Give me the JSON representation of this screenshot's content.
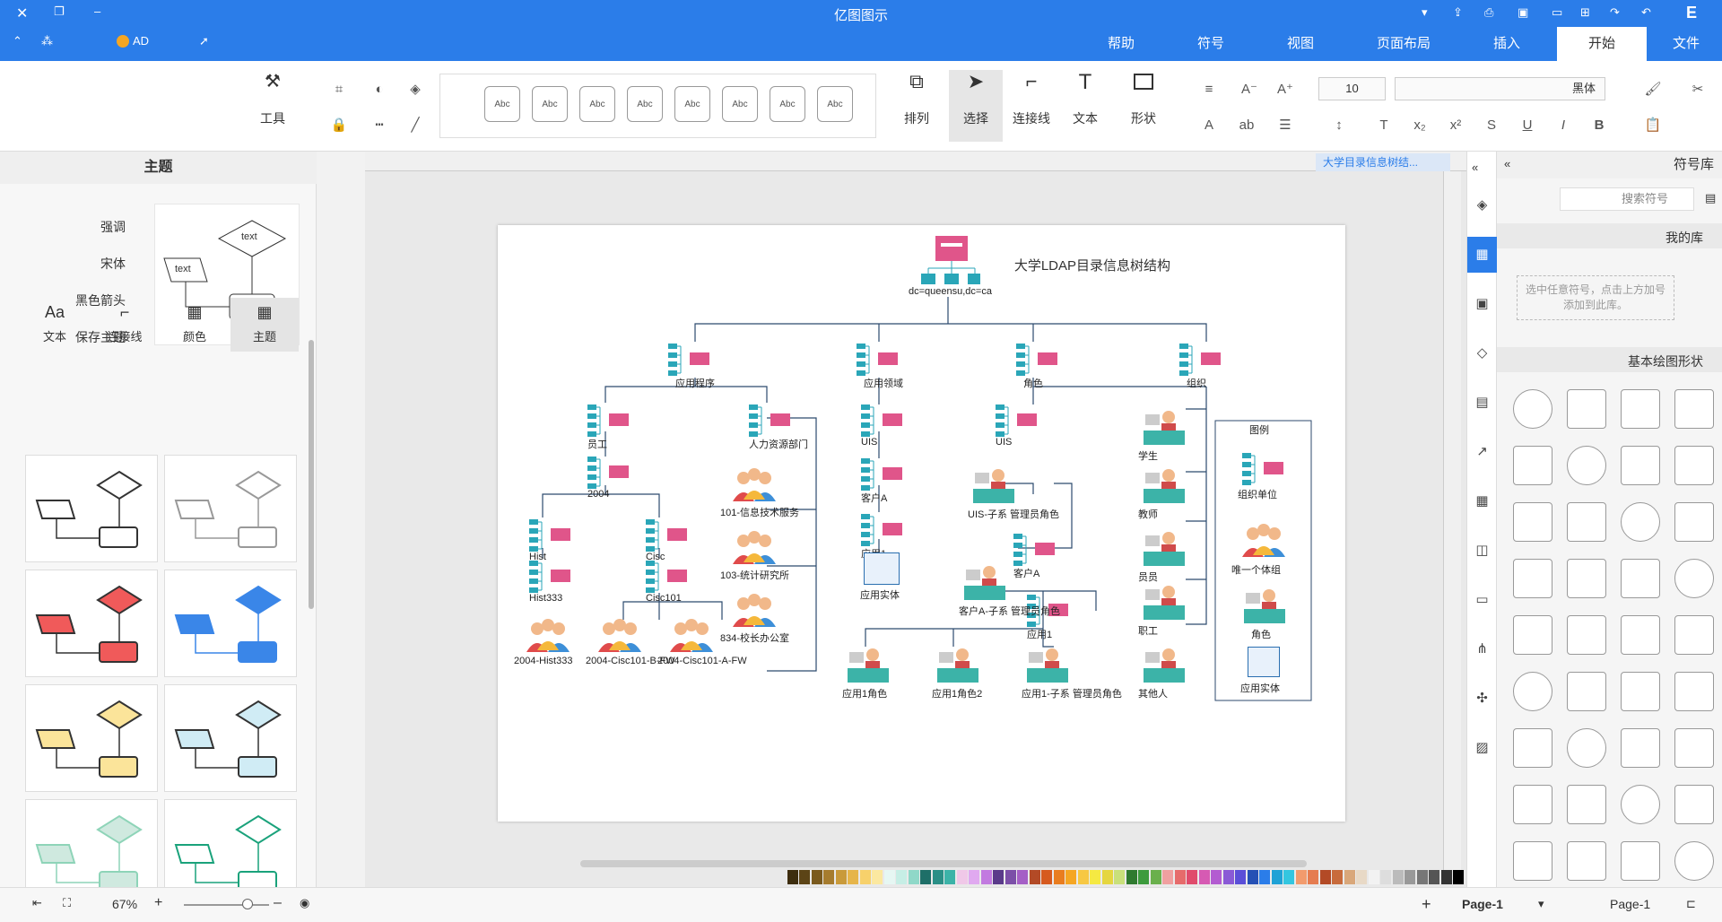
{
  "app": {
    "title": "亿图图示"
  },
  "menu": {
    "tabs": [
      "文件",
      "开始",
      "插入",
      "页面布局",
      "视图",
      "符号",
      "帮助"
    ],
    "active": "开始",
    "ad_label": "AD"
  },
  "ribbon": {
    "font_name": "黑体",
    "font_size": "10",
    "groups": {
      "shape": "形状",
      "text": "文本",
      "connector": "连接线",
      "select": "选择",
      "arrange": "排列",
      "tools": "工具"
    },
    "style_samples": [
      "Abc",
      "Abc",
      "Abc",
      "Abc",
      "Abc",
      "Abc",
      "Abc",
      "Abc"
    ]
  },
  "symbol_panel": {
    "title": "符号库",
    "search_placeholder": "搜索符号",
    "my_library": "我的库",
    "my_library_hint": "选中任意符号，点击上方加号添加到此库。",
    "basic_shapes": "基本绘图形状"
  },
  "document_tab": {
    "name": "大学目录信息树结..."
  },
  "diagram": {
    "title": "大学LDAP目录信息树结构",
    "root_label": "dc=queensu,dc=ca",
    "level1": [
      "组织",
      "角色",
      "应用领域",
      "应用程序"
    ],
    "nodes": {
      "staff": "员工",
      "hr": "人力资源部门",
      "uis1": "UIS",
      "uis2": "UIS",
      "y2004": "2004",
      "ga": "客户A",
      "apps": "应用1",
      "hist": "Hist",
      "cisc": "Cisc",
      "hist333": "Hist333",
      "cisc101": "Cisc101",
      "users101": "101-信息技术服务",
      "users103": "103-统计研究所",
      "users834": "834-校长办公室",
      "uis_admin": "UIS-子系 管理员角色",
      "ga_sub": "客户A",
      "ga_admin": "客户A-子系 管理员角色",
      "app1": "应用1",
      "student": "学生",
      "teacher": "教师",
      "faculty": "员员",
      "worker": "职工",
      "other": "其他人",
      "hist_user": "2004-Hist333",
      "cisc_b": "2004-Cisc101-B-FW",
      "cisc_a": "2004-Cisc101-A-FW",
      "role1": "应用1角色",
      "role2": "应用1角色2",
      "role3": "应用1-子系 管理员角色",
      "app_comp": "应用实体"
    },
    "legend": {
      "title": "图例",
      "items": [
        "组织单位",
        "唯一个体组",
        "角色",
        "应用实体"
      ]
    }
  },
  "theme_panel": {
    "title": "主题",
    "options": [
      "主题",
      "颜色",
      "连接线",
      "文本"
    ],
    "actions": [
      "强调",
      "宋体",
      "黑色箭头",
      "保存主题"
    ],
    "preview_text": [
      "text",
      "text",
      "text"
    ]
  },
  "status": {
    "page_label": "Page-1",
    "page_tab": "Page-1",
    "zoom": "67%"
  },
  "colors": {
    "accent": "#2b7de9",
    "pink": "#e0558a",
    "teal": "#2aa6b8"
  }
}
